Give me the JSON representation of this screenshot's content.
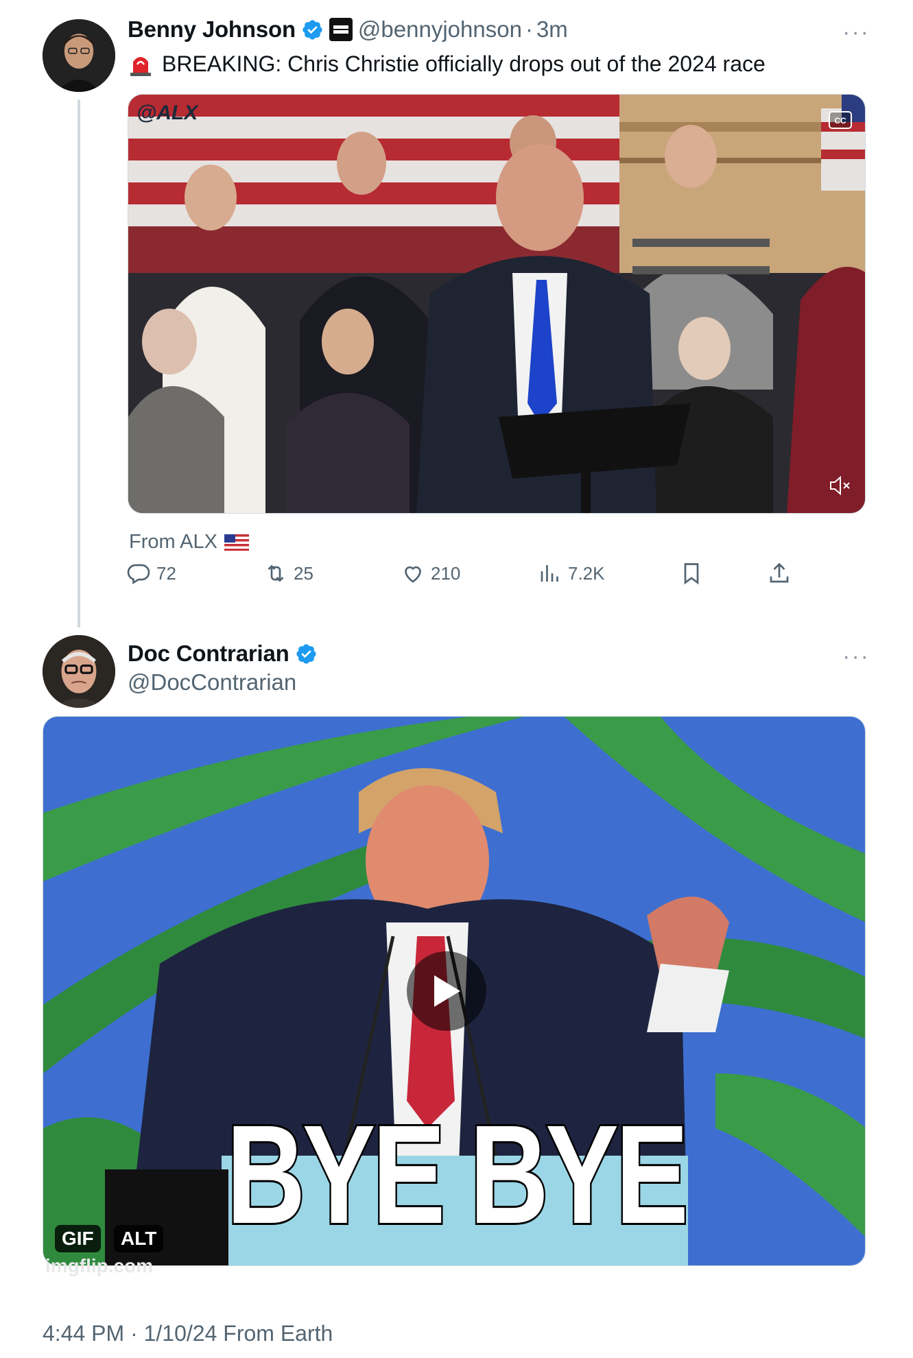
{
  "tweet1": {
    "display_name": "Benny Johnson",
    "handle": "@bennyjohnson",
    "separator": "·",
    "time": "3m",
    "more": "···",
    "text": "BREAKING: Chris Christie officially drops out of the 2024 race",
    "media": {
      "watermark": "@ALX",
      "source_label": "From ALX"
    },
    "actions": {
      "replies": "72",
      "reposts": "25",
      "likes": "210",
      "views": "7.2K"
    },
    "icons": [
      "verified-icon",
      "affiliate-badge-icon",
      "siren-icon",
      "captions-icon",
      "mute-icon",
      "flag-icon",
      "reply-icon",
      "repost-icon",
      "like-icon",
      "views-icon",
      "bookmark-icon",
      "share-icon"
    ]
  },
  "tweet2": {
    "display_name": "Doc Contrarian",
    "handle": "@DocContrarian",
    "more": "···",
    "media": {
      "caption_text": "BYE BYE",
      "gif_badge": "GIF",
      "alt_badge": "ALT",
      "site_watermark": "imgflip.com"
    },
    "timestamp": "4:44 PM · 1/10/24 From Earth"
  },
  "colors": {
    "verified_blue": "#1d9bf0",
    "text_primary": "#0f1419",
    "text_secondary": "#536471",
    "thread_line": "#cfd9de"
  }
}
